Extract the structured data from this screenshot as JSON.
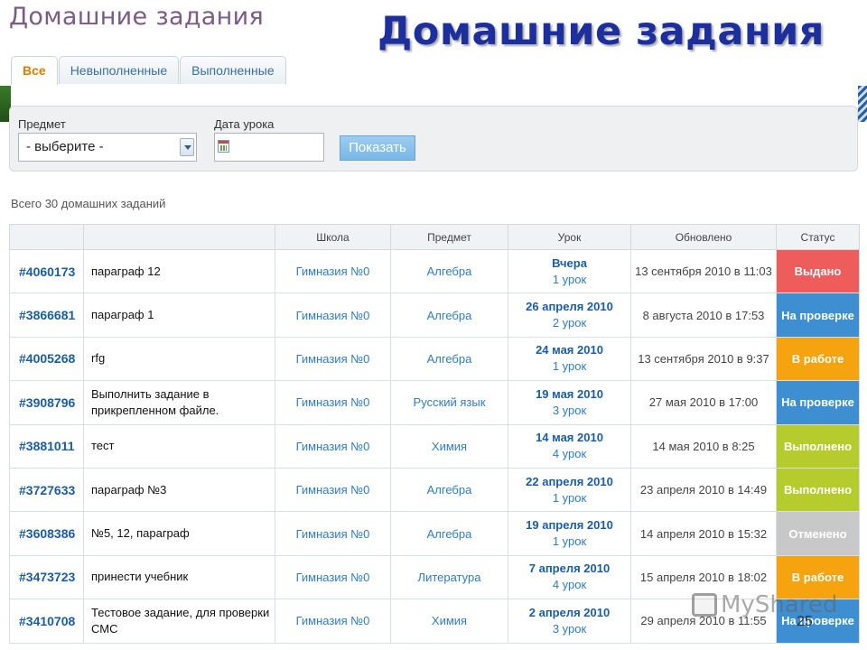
{
  "app": {
    "title": "Домашние задания"
  },
  "slide": {
    "title": "Домашние задания",
    "page_number": "25"
  },
  "tabs": [
    {
      "label": "Все",
      "active": true
    },
    {
      "label": "Невыполненные",
      "active": false
    },
    {
      "label": "Выполненные",
      "active": false
    }
  ],
  "filters": {
    "subject_label": "Предмет",
    "subject_value": "- выберите -",
    "date_label": "Дата урока",
    "date_value": "",
    "show_button": "Показать"
  },
  "summary": {
    "total": "Всего 30 домашних заданий"
  },
  "table": {
    "headers": [
      "",
      "",
      "Школа",
      "Предмет",
      "Урок",
      "Обновлено",
      "Статус"
    ],
    "rows": [
      {
        "id": "#4060173",
        "title": "параграф 12",
        "school": "Гимназия №0",
        "subject": "Алгебра",
        "lesson_date": "Вчера",
        "lesson_num": "1 урок",
        "updated": "13 сентября 2010 в 11:03",
        "status": "Выдано",
        "status_color": "#ef5c5c"
      },
      {
        "id": "#3866681",
        "title": "параграф 1",
        "school": "Гимназия №0",
        "subject": "Алгебра",
        "lesson_date": "26 апреля 2010",
        "lesson_num": "2 урок",
        "updated": "8 августа 2010 в 17:53",
        "status": "На проверке",
        "status_color": "#3d8fd1"
      },
      {
        "id": "#4005268",
        "title": "rfg",
        "school": "Гимназия №0",
        "subject": "Алгебра",
        "lesson_date": "24 мая 2010",
        "lesson_num": "1 урок",
        "updated": "13 сентября 2010 в 9:37",
        "status": "В работе",
        "status_color": "#f5a40f"
      },
      {
        "id": "#3908796",
        "title": "Выполнить задание в прикрепленном файле.",
        "school": "Гимназия №0",
        "subject": "Русский язык",
        "lesson_date": "19 мая 2010",
        "lesson_num": "3 урок",
        "updated": "27 мая 2010 в 17:00",
        "status": "На проверке",
        "status_color": "#3d8fd1"
      },
      {
        "id": "#3881011",
        "title": "тест",
        "school": "Гимназия №0",
        "subject": "Химия",
        "lesson_date": "14 мая 2010",
        "lesson_num": "4 урок",
        "updated": "14 мая 2010 в 8:25",
        "status": "Выполнено",
        "status_color": "#b5cc2c"
      },
      {
        "id": "#3727633",
        "title": "параграф №3",
        "school": "Гимназия №0",
        "subject": "Алгебра",
        "lesson_date": "22 апреля 2010",
        "lesson_num": "1 урок",
        "updated": "23 апреля 2010 в 14:49",
        "status": "Выполнено",
        "status_color": "#b5cc2c"
      },
      {
        "id": "#3608386",
        "title": "№5, 12, параграф",
        "school": "Гимназия №0",
        "subject": "Алгебра",
        "lesson_date": "19 апреля 2010",
        "lesson_num": "1 урок",
        "updated": "14 апреля 2010 в 15:32",
        "status": "Отменено",
        "status_color": "#c8c8c8"
      },
      {
        "id": "#3473723",
        "title": "принести учебник",
        "school": "Гимназия №0",
        "subject": "Литература",
        "lesson_date": "7 апреля 2010",
        "lesson_num": "4 урок",
        "updated": "15 апреля 2010 в 18:02",
        "status": "В работе",
        "status_color": "#f5a40f"
      },
      {
        "id": "#3410708",
        "title": "Тестовое задание, для проверки СМС",
        "school": "Гимназия №0",
        "subject": "Химия",
        "lesson_date": "2 апреля 2010",
        "lesson_num": "3 урок",
        "updated": "29 апреля 2010 в 11:55",
        "status": "На проверке",
        "status_color": "#3d8fd1"
      }
    ]
  },
  "watermark": {
    "text": "MyShared",
    "icon": "presentation-icon"
  }
}
